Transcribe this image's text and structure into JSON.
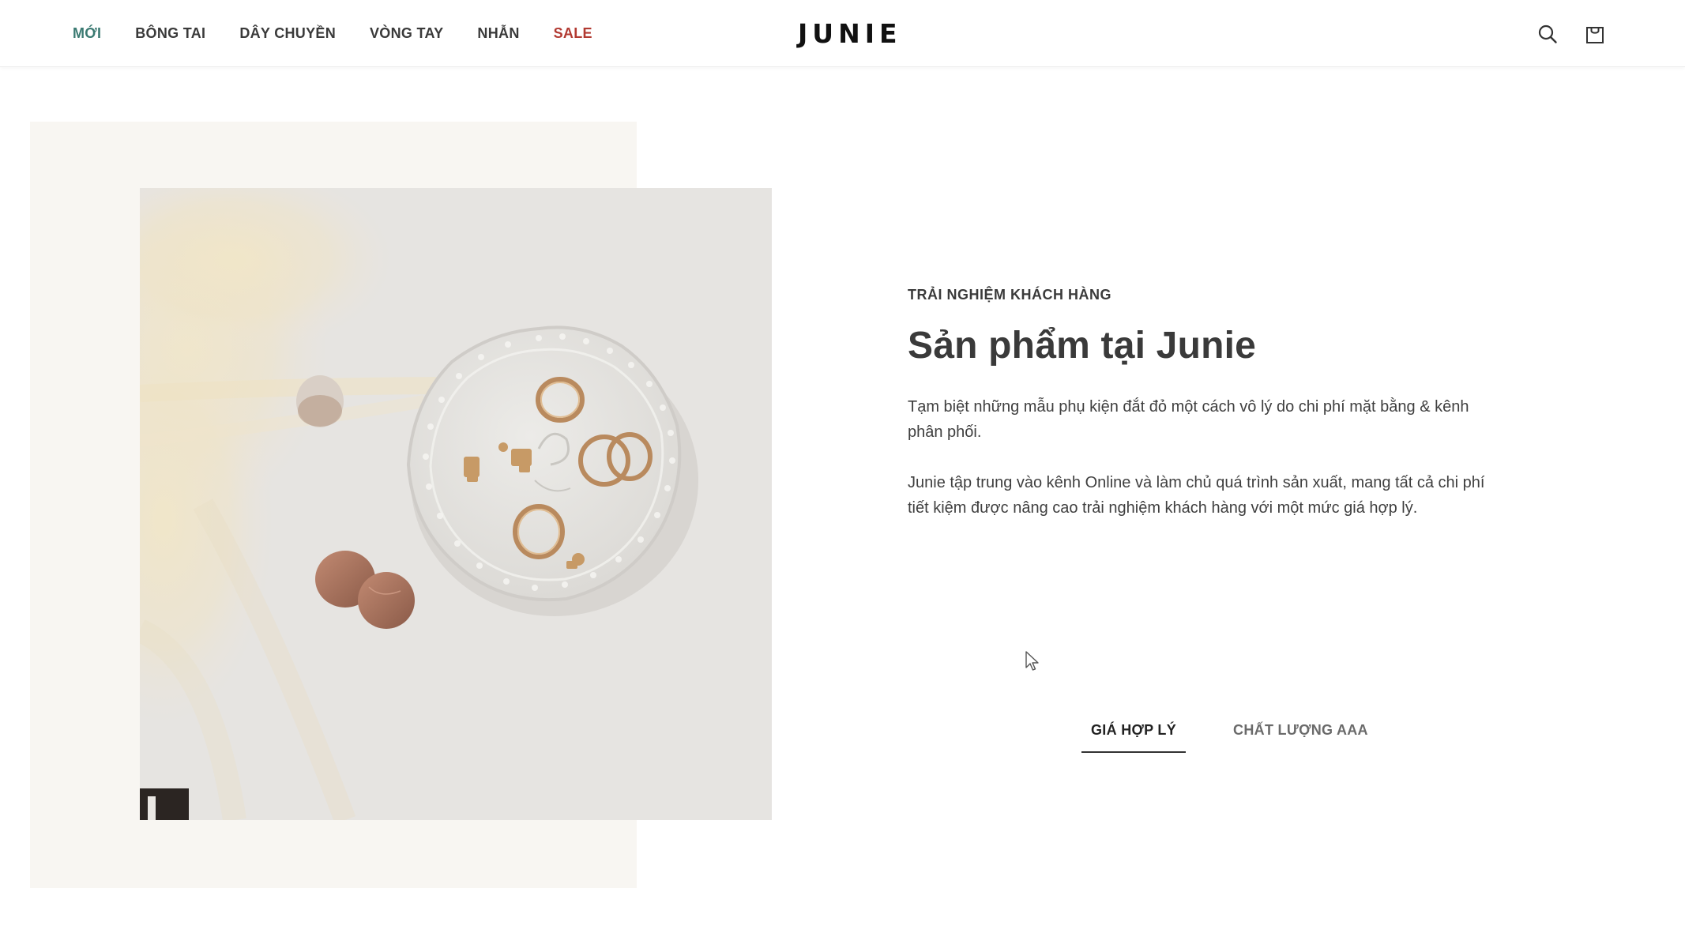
{
  "header": {
    "nav": [
      {
        "label": "MỚI",
        "name": "nav-item-moi",
        "variant": "new"
      },
      {
        "label": "BÔNG TAI",
        "name": "nav-item-bong-tai",
        "variant": ""
      },
      {
        "label": "DÂY CHUYỀN",
        "name": "nav-item-day-chuyen",
        "variant": ""
      },
      {
        "label": "VÒNG TAY",
        "name": "nav-item-vong-tay",
        "variant": ""
      },
      {
        "label": "NHẪN",
        "name": "nav-item-nhan",
        "variant": ""
      },
      {
        "label": "SALE",
        "name": "nav-item-sale",
        "variant": "sale"
      }
    ],
    "logo": "JUNIE",
    "icons": [
      "search-icon",
      "shopping-bag-icon"
    ]
  },
  "content": {
    "eyebrow": "TRẢI NGHIỆM KHÁCH HÀNG",
    "title": "Sản phẩm tại Junie",
    "paragraph_1": "Tạm biệt những mẫu phụ kiện đắt đỏ một cách vô lý do chi phí mặt bằng & kênh phân phối.",
    "paragraph_2": "Junie tập trung vào kênh Online và làm chủ quá trình sản xuất, mang tất cả chi phí tiết kiệm được nâng cao trải nghiệm khách hàng với một mức giá hợp lý."
  },
  "tabs": [
    {
      "label": "GIÁ HỢP LÝ",
      "active": true
    },
    {
      "label": "CHẤT LƯỢNG AAA",
      "active": false
    }
  ],
  "colors": {
    "accent_new": "#3b7a72",
    "sale": "#b23a32",
    "panel_bg": "#f8f6f2"
  }
}
